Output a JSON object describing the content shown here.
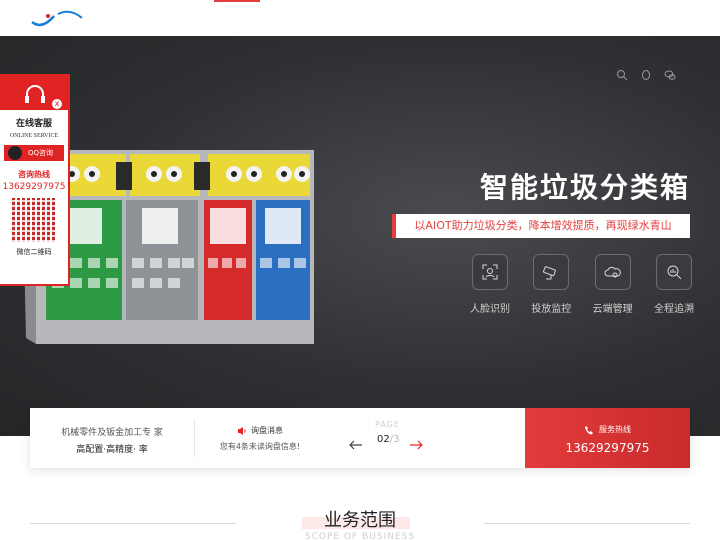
{
  "hero": {
    "title": "智能垃圾分类箱",
    "tagline": "以AIOT助力垃圾分类，降本增效提质，再现绿水青山",
    "features": [
      {
        "label": "人脸识别",
        "icon": "face-scan-icon"
      },
      {
        "label": "投放监控",
        "icon": "camera-icon"
      },
      {
        "label": "云端管理",
        "icon": "cloud-gear-icon"
      },
      {
        "label": "全程追溯",
        "icon": "search-chart-icon"
      }
    ],
    "top_icons": [
      "search-icon",
      "qq-icon",
      "wechat-icon"
    ]
  },
  "service_panel": {
    "title": "在线客服",
    "subtitle": "ONLINE SERVICE",
    "qq_label": "QQ咨询",
    "hotline_label": "咨询热线",
    "hotline": "13629297975",
    "wechat_label": "微信二维码",
    "close": "x"
  },
  "info_bar": {
    "company_line1": "机械零件及钣金加工专 家",
    "company_line2": "高配置·高精度· 率",
    "news_title": "询盘消息",
    "news_text": "您有4条未读询盘信息!",
    "page_label": "PAGE",
    "page_current": "02",
    "page_total": "/3",
    "hotline_label": "服务热线",
    "hotline": "13629297975"
  },
  "section": {
    "title": "业务范围",
    "subtitle": "SCOPE OF BUSINESS"
  },
  "colors": {
    "accent": "#e02424",
    "hero_bg": "#2f3033"
  }
}
